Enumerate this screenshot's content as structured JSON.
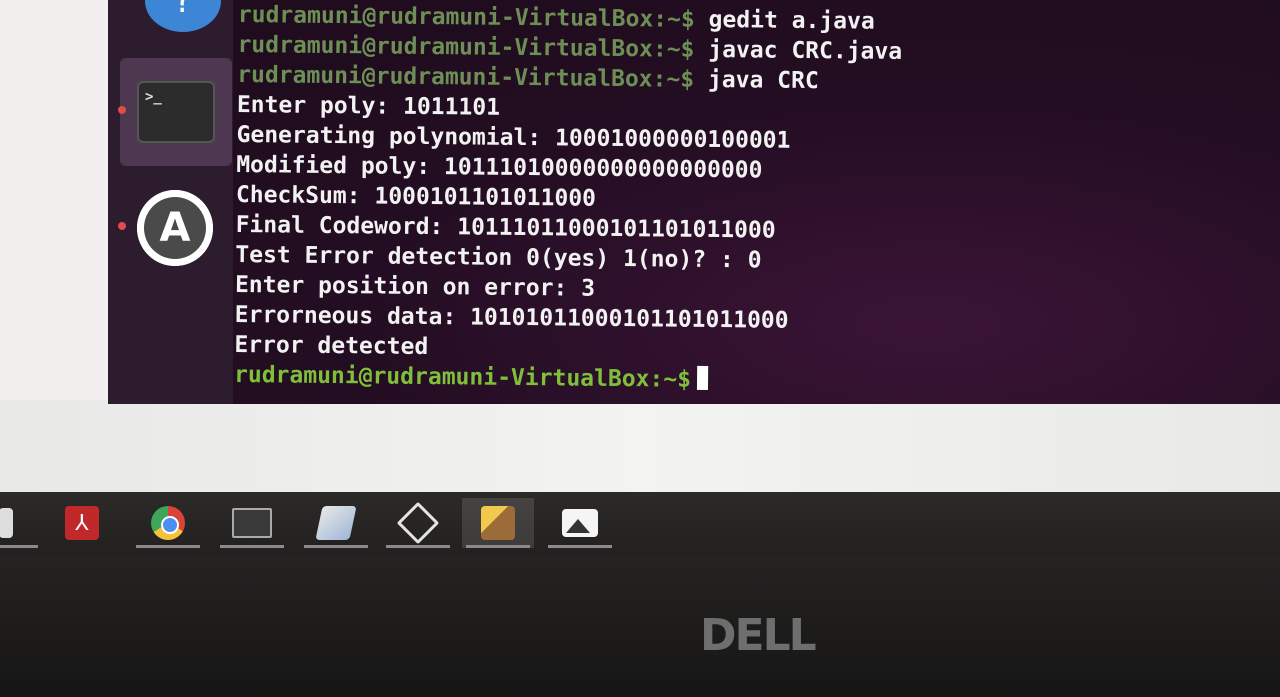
{
  "terminal": {
    "prompt": "rudramuni@rudramuni-VirtualBox:~$",
    "lines": [
      {
        "prompt": "rudramuni@rudramuni-VirtualBox:~$",
        "command": " gedit a.java"
      },
      {
        "prompt": "rudramuni@rudramuni-VirtualBox:~$",
        "command": " javac CRC.java"
      },
      {
        "prompt": "rudramuni@rudramuni-VirtualBox:~$",
        "command": " java CRC"
      }
    ],
    "output": [
      "Enter poly: 1011101",
      "Generating polynomial: 10001000000100001",
      "Modified poly: 10111010000000000000000",
      "CheckSum: 1000101101011000",
      "Final Codeword: 10111011000101101011000",
      "Test Error detection 0(yes) 1(no)? : 0",
      "Enter position on error: 3",
      "Errorneous data: 10101011000101101011000",
      "Error detected"
    ],
    "final_prompt": "rudramuni@rudramuni-VirtualBox:~$"
  },
  "dock": {
    "help_glyph": "?",
    "terminal_glyph": ">_",
    "store_glyph": "A",
    "icons": [
      "help-icon",
      "terminal-icon",
      "software-store-icon",
      "show-apps-icon"
    ]
  },
  "taskbar": {
    "icons": [
      "file-icon",
      "pdf-icon",
      "chrome-icon",
      "cmd-icon",
      "book-icon",
      "virtualbox-icon",
      "paint-icon",
      "photos-icon"
    ],
    "pdf_glyph": "⅄"
  },
  "bezel": {
    "brand": "DELL"
  },
  "colors": {
    "prompt": "#7fbf3a",
    "terminal_bg": "#230d22",
    "text": "#f2f2f2"
  }
}
